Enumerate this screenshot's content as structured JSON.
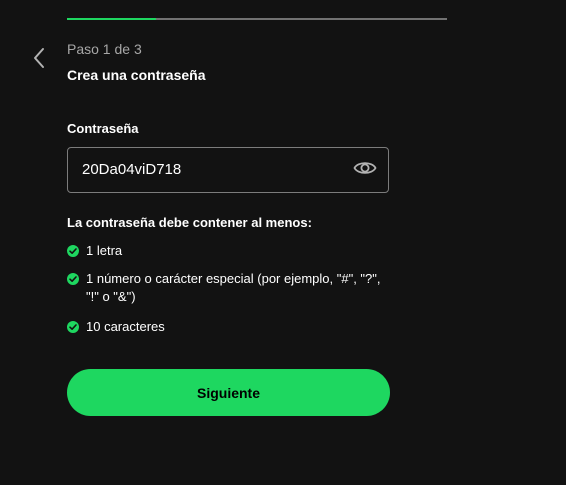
{
  "progress": {
    "value": 0.233,
    "accent_color": "#1ed760",
    "track_color": "#727272"
  },
  "header": {
    "back_icon": "chevron-left-icon",
    "step_label": "Paso 1 de 3",
    "title": "Crea una contraseña"
  },
  "password": {
    "label": "Contraseña",
    "value": "20Da04viD718",
    "toggle_icon": "eye-icon"
  },
  "requirements": {
    "title": "La contraseña debe contener al menos:",
    "check_icon": "check-circle-icon",
    "check_color": "#1ed760",
    "items": [
      "1 letra",
      "1 número o carácter especial (por ejemplo, \"#\", \"?\", \"!\" o \"&\")",
      "10 caracteres"
    ]
  },
  "actions": {
    "next_label": "Siguiente"
  }
}
